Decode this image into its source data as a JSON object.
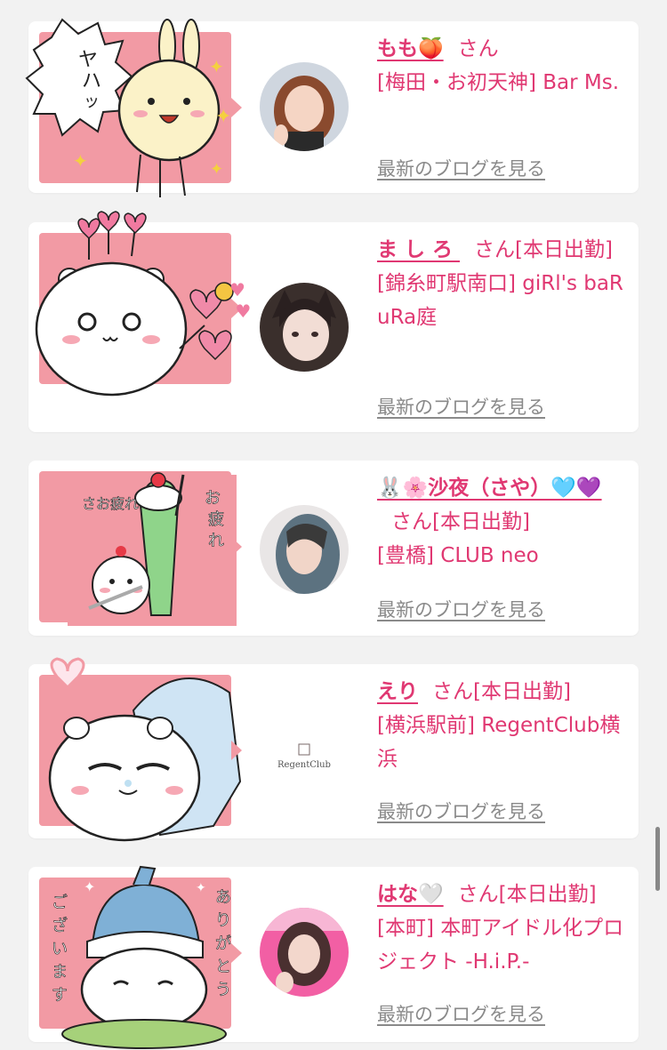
{
  "entries": [
    {
      "name": "もも🍑",
      "suffix": "さん",
      "status": "",
      "shop": "[梅田・お初天神] Bar Ms.",
      "link": "最新のブログを見る",
      "stamp_text": "ヤハッッ"
    },
    {
      "name": "ましろ",
      "suffix": "さん",
      "status": "[本日出勤]",
      "shop": "[錦糸町駅南口] giRl's baR uRa庭",
      "link": "最新のブログを見る",
      "stamp_text": ""
    },
    {
      "name": "🐰🌸沙夜（さや）🩵💜",
      "suffix": "さん",
      "status": "[本日出勤]",
      "shop": "[豊橋] CLUB neo",
      "link": "最新のブログを見る",
      "stamp_text": "お疲れさまです"
    },
    {
      "name": "えり",
      "suffix": "さん",
      "status": "[本日出勤]",
      "shop": "[横浜駅前] RegentClub横浜",
      "link": "最新のブログを見る",
      "stamp_text": "",
      "avatar_logo": "RegentClub"
    },
    {
      "name": "はな🤍",
      "suffix": "さん",
      "status": "[本日出勤]",
      "shop": "[本町] 本町アイドル化プロジェクト -H.i.P.-",
      "link": "最新のブログを見る",
      "stamp_text": "ありがとうございます"
    }
  ],
  "colors": {
    "accent": "#e03872",
    "stamp_bg": "#f29aa4",
    "link": "#8a8a8a",
    "page_bg": "#f2f2f2"
  }
}
